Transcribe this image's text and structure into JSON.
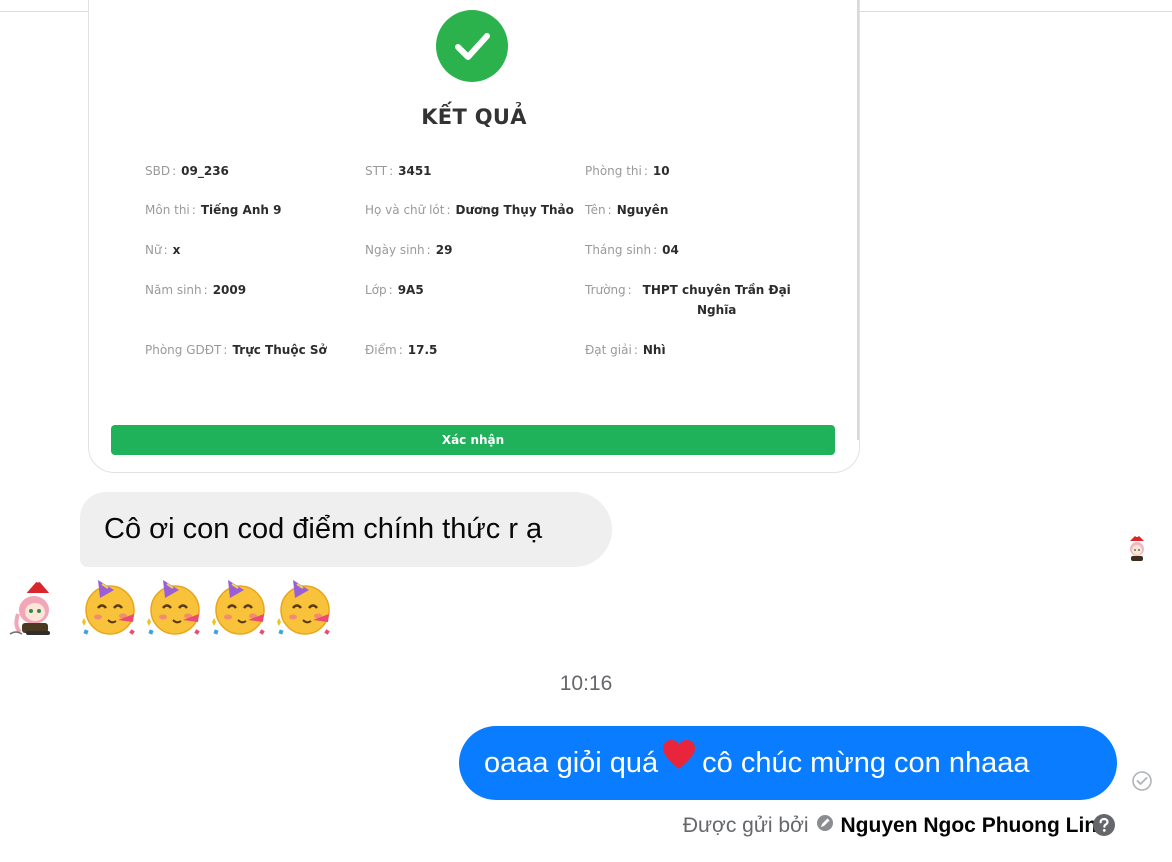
{
  "result_card": {
    "title": "KẾT QUẢ",
    "fields": [
      {
        "label": "SBD",
        "value": "09_236"
      },
      {
        "label": "STT",
        "value": "3451"
      },
      {
        "label": "Phòng thi",
        "value": "10"
      },
      {
        "label": "Môn thi",
        "value": "Tiếng Anh 9"
      },
      {
        "label": "Họ và chữ lót",
        "value": "Dương Thụy Thảo"
      },
      {
        "label": "Tên",
        "value": "Nguyên"
      },
      {
        "label": "Nữ",
        "value": "x"
      },
      {
        "label": "Ngày sinh",
        "value": "29"
      },
      {
        "label": "Tháng sinh",
        "value": "04"
      },
      {
        "label": "Năm sinh",
        "value": "2009"
      },
      {
        "label": "Lớp",
        "value": "9A5"
      },
      {
        "label": "Trường",
        "value": "THPT chuyên Trần Đại Nghĩa"
      },
      {
        "label": "Phòng GDĐT",
        "value": "Trực Thuộc Sở"
      },
      {
        "label": "Điểm",
        "value": "17.5"
      },
      {
        "label": "Đạt giải",
        "value": "Nhì"
      }
    ],
    "confirm_button": "Xác nhận"
  },
  "messages": {
    "received_text": "Cô ơi con cod điểm chính thức r ạ",
    "emoji_icons": [
      "partying-face",
      "partying-face",
      "partying-face",
      "partying-face"
    ],
    "timestamp": "10:16",
    "sent_text_before": "oaaa giỏi quá",
    "sent_text_after": "cô chúc mừng con nhaaa",
    "sent_by_prefix": "Được gửi bởi",
    "sent_by_name": "Nguyen Ngoc Phuong Linh"
  },
  "colors": {
    "sent_bubble": "#0a7cff",
    "received_bubble": "#efefef",
    "success_green": "#2bb24c",
    "confirm_green": "#1fb25a",
    "heart": "#e8253a"
  }
}
